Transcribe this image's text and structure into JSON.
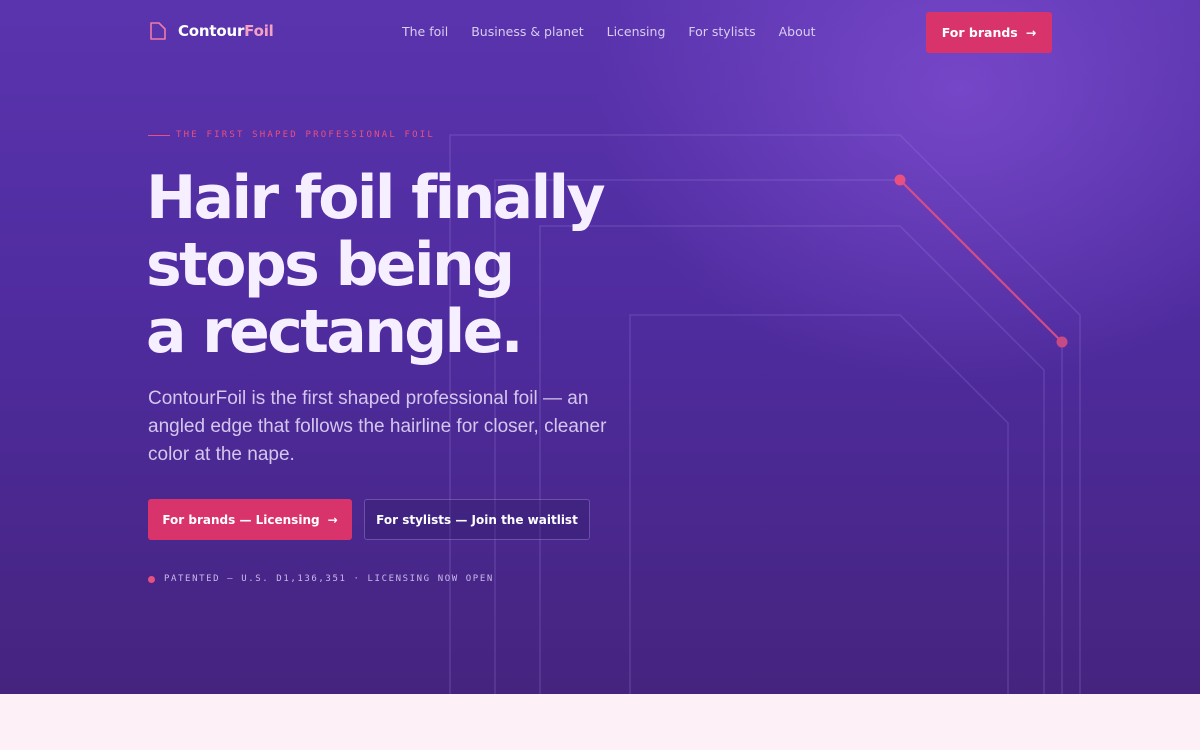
{
  "nav": {
    "logo": {
      "prefix": "Contour",
      "accent": "Foil"
    },
    "links": [
      "The foil",
      "Business & planet",
      "Licensing",
      "For stylists",
      "About"
    ],
    "cta": {
      "label": "For brands",
      "arrow": "→"
    }
  },
  "hero": {
    "eyebrow": "THE FIRST SHAPED PROFESSIONAL FOIL",
    "headline_lines": [
      "Hair foil finally",
      "stops being",
      "a rectangle."
    ],
    "subhead": "ContourFoil is the first shaped professional foil — an angled edge that follows the hairline for closer, cleaner color at the nape.",
    "primary_button": {
      "label": "For brands — Licensing",
      "arrow": "→"
    },
    "secondary_button": {
      "label": "For stylists — Join the waitlist"
    },
    "patent_note": "PATENTED — U.S. D1,136,351 · LICENSING NOW OPEN"
  },
  "colors": {
    "accent": "#d9336b",
    "hero_bg": "#52309f",
    "lower_bg": "#fdf1f7"
  },
  "icons": {
    "logo": "foil-icon",
    "decoration": "foil-outline-diagram"
  }
}
